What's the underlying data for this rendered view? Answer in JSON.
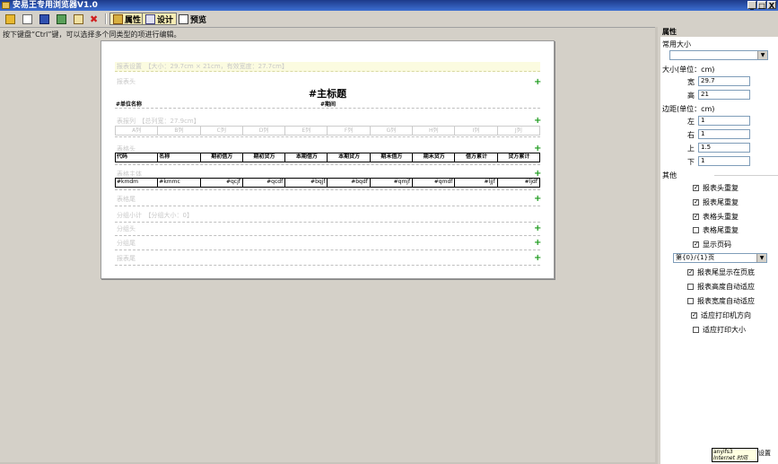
{
  "window": {
    "title": "安易王专用浏览器V1.0",
    "min": "_",
    "max": "□",
    "close": "X"
  },
  "toolbar": {
    "props_label": "属性",
    "design_label": "设计",
    "preview_label": "预览"
  },
  "hint": "按下键盘“Ctrl”键，可以选择多个同类型的项进行编辑。",
  "report": {
    "settings_band": "报表设置　【大小：29.7cm × 21cm，有效宽度：27.7cm】",
    "header_band": "报表头",
    "main_title": "#主标题",
    "unit_name": "#单位名称",
    "period": "#期间",
    "col_band": "表报列　【总列宽：27.9cm】",
    "columns": [
      "A列",
      "B列",
      "C列",
      "D列",
      "E列",
      "F列",
      "G列",
      "H列",
      "I列",
      "J列"
    ],
    "table_head_band": "表格头",
    "headers": [
      "代码",
      "名称",
      "期初借方",
      "期初贷方",
      "本期借方",
      "本期贷方",
      "期末借方",
      "期末贷方",
      "借方累计",
      "贷方累计"
    ],
    "body_band": "表格主体",
    "row": [
      "#kmdm",
      "#kmmc",
      "#qcjf",
      "#qcdf",
      "#bqjf",
      "#bqdf",
      "#qmjf",
      "#qmdf",
      "#ljjf",
      "#ljdf"
    ],
    "table_foot_band": "表格尾",
    "group_band": "分组小计　【分组大小：0】",
    "group_head_band": "分组头",
    "group_foot_band": "分组尾",
    "report_foot_band": "报表尾"
  },
  "panel": {
    "title": "属性",
    "common_size": "常用大小",
    "size_section": "大小(单位：cm)",
    "width_label": "宽",
    "width": "29.7",
    "height_label": "高",
    "height": "21",
    "margin_section": "边距(单位：cm)",
    "left_label": "左",
    "left": "1",
    "right_label": "右",
    "right": "1",
    "top_label": "上",
    "top": "1.5",
    "bottom_label": "下",
    "bottom": "1",
    "other_section": "其他",
    "chk_report_head": "报表头重复",
    "chk_report_foot": "报表尾重复",
    "chk_table_head": "表格头重复",
    "chk_table_foot": "表格尾重复",
    "chk_page_no": "显示页码",
    "page_format": "第{0}/{1}页",
    "chk_foot_last": "报表尾显示在页底",
    "chk_auto_height": "报表高度自动适应",
    "chk_auto_width": "报表宽度自动适应",
    "chk_orient": "适应打印机方向",
    "chk_print_size": "适应打印大小"
  },
  "tooltip": {
    "line1": "anyifs3",
    "line2": "Internet 时间",
    "button": "设置"
  }
}
